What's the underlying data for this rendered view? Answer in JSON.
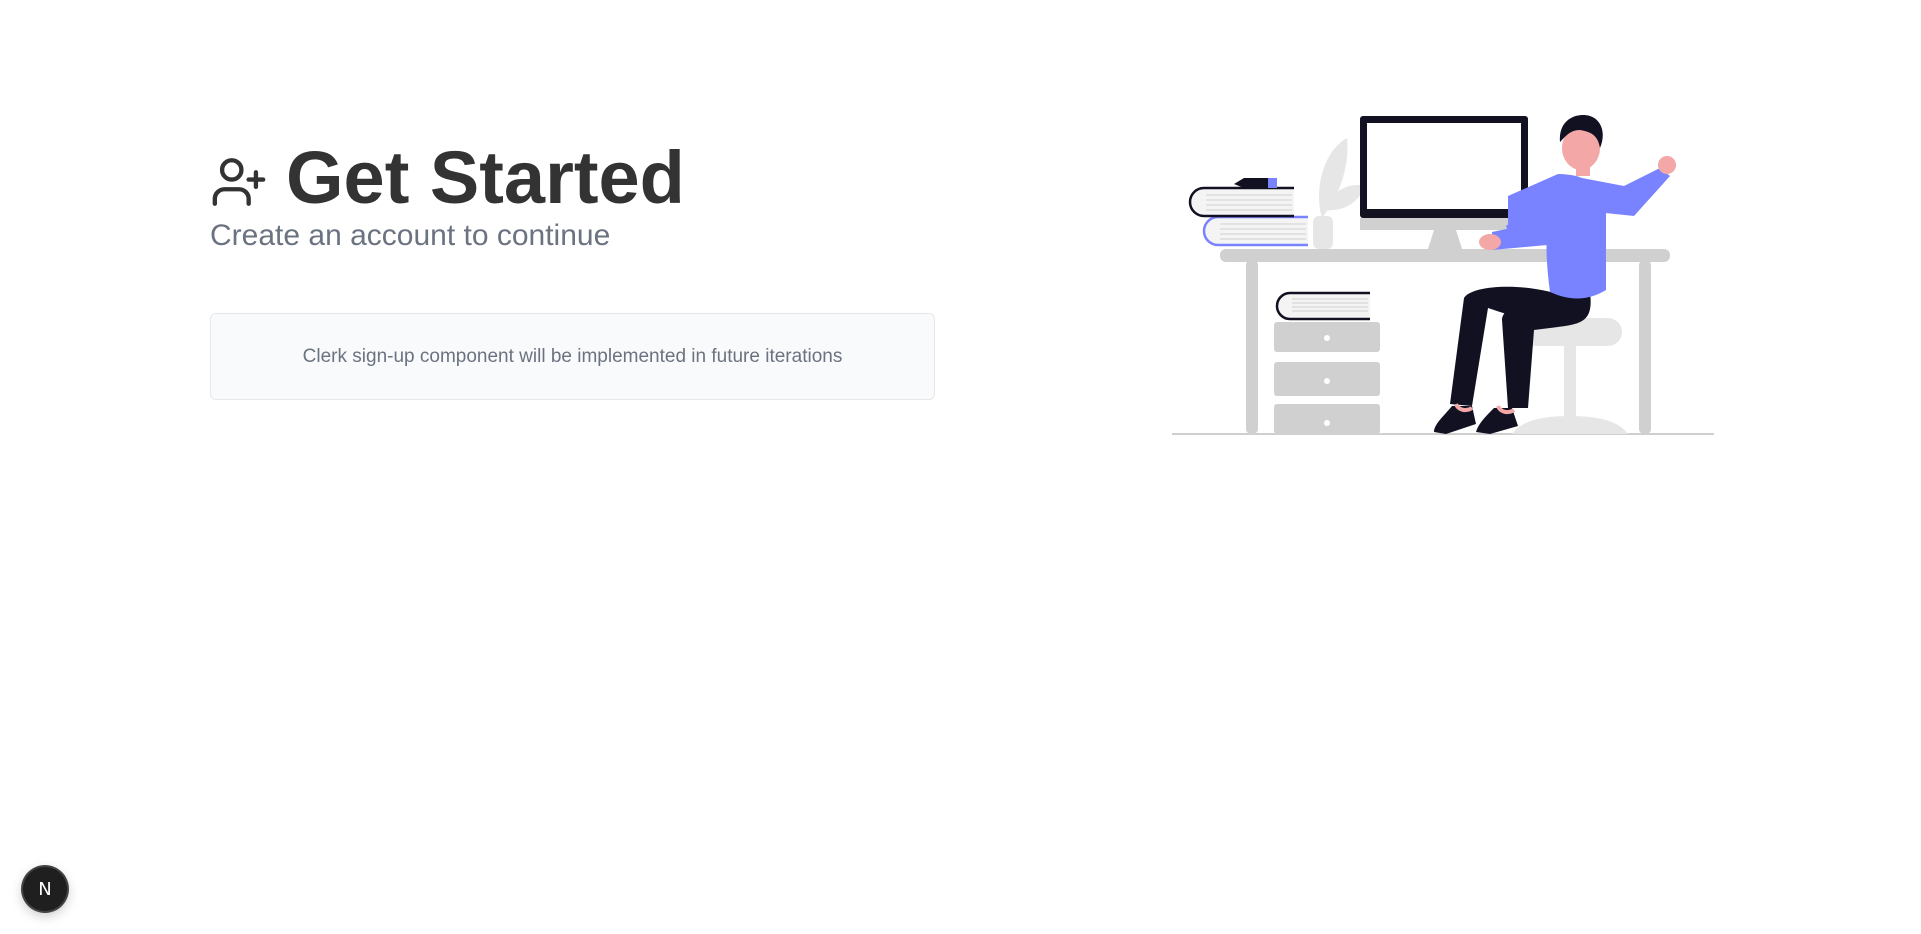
{
  "heading": {
    "icon": "user-plus-icon",
    "title": "Get Started",
    "subtitle": "Create an account to continue"
  },
  "signup_placeholder": {
    "text": "Clerk sign-up component will be implemented in future iterations"
  },
  "illustration": {
    "icon": "person-at-desk-illustration",
    "accent_color": "#7a83ff"
  },
  "dev_indicator": {
    "label": "N",
    "icon": "nextjs-logo-icon"
  },
  "colors": {
    "title": "#333333",
    "subtitle": "#6b7280",
    "panel_bg": "#f9fafb",
    "panel_border": "#e5e7eb"
  }
}
